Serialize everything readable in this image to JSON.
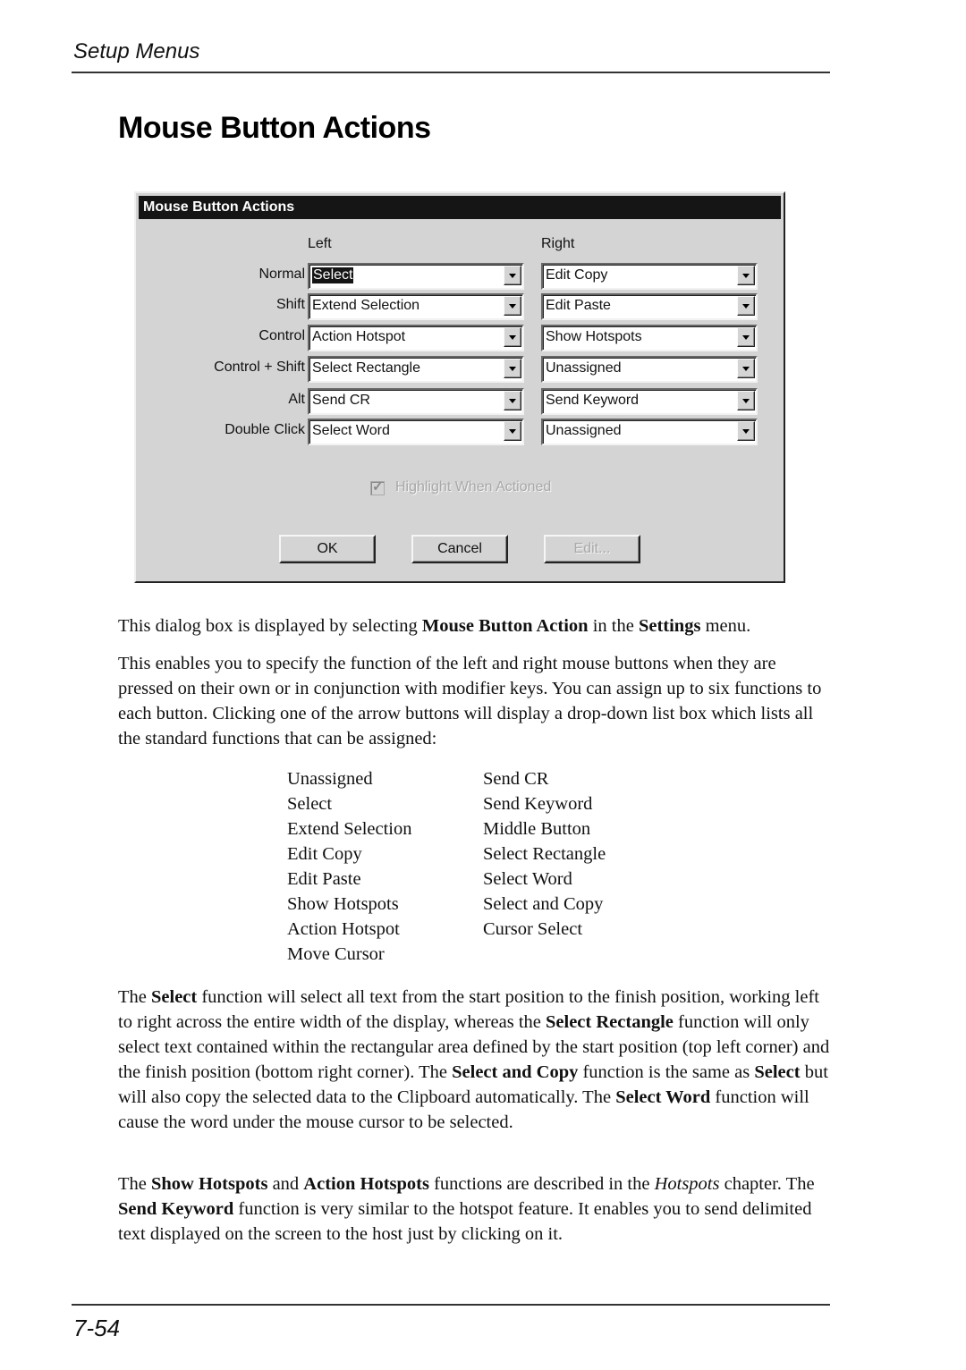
{
  "page": {
    "running_header": "Setup Menus",
    "title": "Mouse Button Actions",
    "page_number": "7-54"
  },
  "dialog": {
    "title": "Mouse Button Actions",
    "column_headers": {
      "left": "Left",
      "right": "Right"
    },
    "rows": [
      {
        "label": "Normal",
        "left": "Select",
        "right": "Edit Copy"
      },
      {
        "label": "Shift",
        "left": "Extend Selection",
        "right": "Edit Paste"
      },
      {
        "label": "Control",
        "left": "Action Hotspot",
        "right": "Show Hotspots"
      },
      {
        "label": "Control + Shift",
        "left": "Select Rectangle",
        "right": "Unassigned"
      },
      {
        "label": "Alt",
        "left": "Send CR",
        "right": "Send Keyword"
      },
      {
        "label": "Double Click",
        "left": "Select Word",
        "right": "Unassigned"
      }
    ],
    "highlight_checkbox": {
      "label": "Highlight When Actioned",
      "checked": true,
      "disabled": true
    },
    "buttons": {
      "ok": "OK",
      "cancel": "Cancel",
      "edit": "Edit..."
    }
  },
  "body": {
    "para1": [
      {
        "t": "This dialog box is displayed by selecting "
      },
      {
        "t": "Mouse Button Action",
        "b": true
      },
      {
        "t": " in the "
      },
      {
        "t": "Settings",
        "b": true
      },
      {
        "t": " menu."
      }
    ],
    "para2": [
      {
        "t": "This enables you to specify the function of the left and right mouse buttons when they are pressed on their own or in conjunction with modifier keys. You can assign up to six functions to each button. Clicking one of the arrow buttons will display a drop-down list box which lists all the standard functions that can be assigned:"
      }
    ],
    "functions_col1": [
      "Unassigned",
      "Select",
      "Extend Selection",
      "Edit Copy",
      "Edit Paste",
      "Show Hotspots",
      "Action Hotspot",
      "Move Cursor"
    ],
    "functions_col2": [
      "Send CR",
      "Send Keyword",
      "Middle Button",
      "Select Rectangle",
      "Select Word",
      "Select and Copy",
      "Cursor Select"
    ],
    "para3": [
      {
        "t": "The "
      },
      {
        "t": "Select",
        "b": true
      },
      {
        "t": " function will select all text from the start position to the finish position, working left to right across the entire width of the display, whereas the "
      },
      {
        "t": "Select Rectangle",
        "b": true
      },
      {
        "t": " function will only select text contained within the rectangular area defined by the start position (top left corner) and the finish position (bottom right corner). The "
      },
      {
        "t": "Select and Copy",
        "b": true
      },
      {
        "t": " function is the same as "
      },
      {
        "t": "Select",
        "b": true
      },
      {
        "t": " but will also copy the selected data to the Clipboard automatically. The "
      },
      {
        "t": "Select Word",
        "b": true
      },
      {
        "t": " function will cause the word under the mouse cursor to be selected."
      }
    ],
    "para4": [
      {
        "t": "The "
      },
      {
        "t": "Show Hotspots",
        "b": true
      },
      {
        "t": " and "
      },
      {
        "t": "Action Hotspots",
        "b": true
      },
      {
        "t": " functions are described in the "
      },
      {
        "t": "Hotspots",
        "i": true
      },
      {
        "t": " chapter. The "
      },
      {
        "t": "Send Keyword",
        "b": true
      },
      {
        "t": " function is very similar to the hotspot feature. It enables you to send delimited text displayed on the screen to the host just by clicking on it."
      }
    ]
  }
}
